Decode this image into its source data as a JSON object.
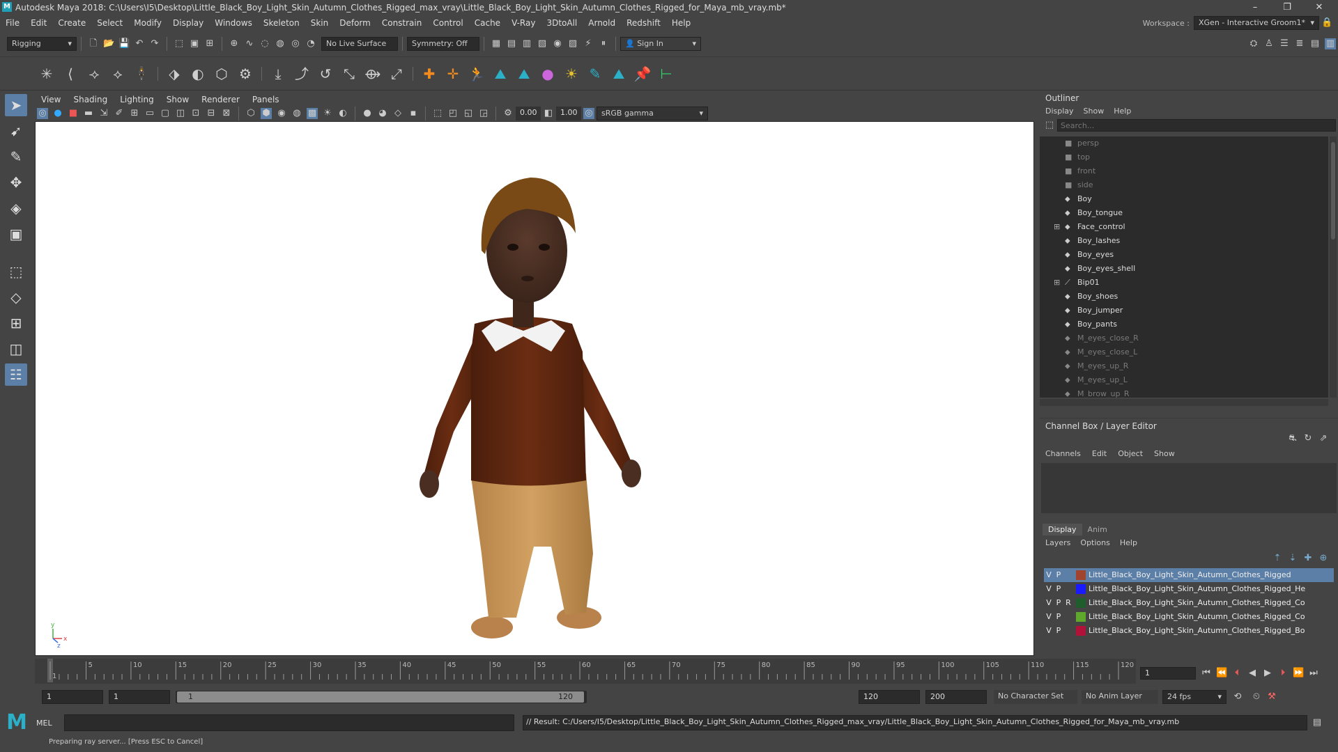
{
  "window": {
    "title": "Autodesk Maya 2018: C:\\Users\\I5\\Desktop\\Little_Black_Boy_Light_Skin_Autumn_Clothes_Rigged_max_vray\\Little_Black_Boy_Light_Skin_Autumn_Clothes_Rigged_for_Maya_mb_vray.mb*",
    "minimize": "–",
    "maximize": "❐",
    "close": "✕"
  },
  "menu": [
    "File",
    "Edit",
    "Create",
    "Select",
    "Modify",
    "Display",
    "Windows",
    "Skeleton",
    "Skin",
    "Deform",
    "Constrain",
    "Control",
    "Cache",
    "V-Ray",
    "3DtoAll",
    "Arnold",
    "Redshift",
    "Help"
  ],
  "workspace": {
    "label": "Workspace :",
    "value": "XGen - Interactive Groom1*"
  },
  "status": {
    "mode": "Rigging",
    "live_surface": "No Live Surface",
    "symmetry": "Symmetry: Off",
    "sign_in": "Sign In"
  },
  "viewport": {
    "menu": [
      "View",
      "Shading",
      "Lighting",
      "Show",
      "Renderer",
      "Panels"
    ],
    "exposure": "0.00",
    "gamma": "1.00",
    "color_space": "sRGB gamma",
    "axis_y": "y",
    "axis_x": "x",
    "axis_z": "z"
  },
  "outliner": {
    "title": "Outliner",
    "menu": [
      "Display",
      "Show",
      "Help"
    ],
    "search_placeholder": "Search...",
    "items": [
      {
        "label": "persp",
        "kind": "camera",
        "dim": true,
        "expand": false
      },
      {
        "label": "top",
        "kind": "camera",
        "dim": true,
        "expand": false
      },
      {
        "label": "front",
        "kind": "camera",
        "dim": true,
        "expand": false
      },
      {
        "label": "side",
        "kind": "camera",
        "dim": true,
        "expand": false
      },
      {
        "label": "Boy",
        "kind": "mesh",
        "dim": false,
        "expand": false
      },
      {
        "label": "Boy_tongue",
        "kind": "mesh",
        "dim": false,
        "expand": false
      },
      {
        "label": "Face_control",
        "kind": "mesh",
        "dim": false,
        "expand": true
      },
      {
        "label": "Boy_lashes",
        "kind": "mesh",
        "dim": false,
        "expand": false
      },
      {
        "label": "Boy_eyes",
        "kind": "mesh",
        "dim": false,
        "expand": false
      },
      {
        "label": "Boy_eyes_shell",
        "kind": "mesh",
        "dim": false,
        "expand": false
      },
      {
        "label": "Bip01",
        "kind": "joint",
        "dim": false,
        "expand": true
      },
      {
        "label": "Boy_shoes",
        "kind": "mesh",
        "dim": false,
        "expand": false
      },
      {
        "label": "Boy_jumper",
        "kind": "mesh",
        "dim": false,
        "expand": false
      },
      {
        "label": "Boy_pants",
        "kind": "mesh",
        "dim": false,
        "expand": false
      },
      {
        "label": "M_eyes_close_R",
        "kind": "mesh",
        "dim": true,
        "expand": false
      },
      {
        "label": "M_eyes_close_L",
        "kind": "mesh",
        "dim": true,
        "expand": false
      },
      {
        "label": "M_eyes_up_R",
        "kind": "mesh",
        "dim": true,
        "expand": false
      },
      {
        "label": "M_eyes_up_L",
        "kind": "mesh",
        "dim": true,
        "expand": false
      },
      {
        "label": "M_brow_up_R",
        "kind": "mesh",
        "dim": true,
        "expand": false
      }
    ]
  },
  "channel_box": {
    "title": "Channel Box / Layer Editor",
    "menu": [
      "Channels",
      "Edit",
      "Object",
      "Show"
    ]
  },
  "layer_editor": {
    "tabs": [
      "Display",
      "Anim"
    ],
    "menu": [
      "Layers",
      "Options",
      "Help"
    ],
    "layers": [
      {
        "v": "V",
        "p": "P",
        "r": "",
        "color": "#a0442f",
        "name": "Little_Black_Boy_Light_Skin_Autumn_Clothes_Rigged",
        "selected": true
      },
      {
        "v": "V",
        "p": "P",
        "r": "",
        "color": "#1a1aff",
        "name": "Little_Black_Boy_Light_Skin_Autumn_Clothes_Rigged_He",
        "selected": false
      },
      {
        "v": "V",
        "p": "P",
        "r": "R",
        "color": "#1f5e2c",
        "name": "Little_Black_Boy_Light_Skin_Autumn_Clothes_Rigged_Co",
        "selected": false
      },
      {
        "v": "V",
        "p": "P",
        "r": "",
        "color": "#5fa82c",
        "name": "Little_Black_Boy_Light_Skin_Autumn_Clothes_Rigged_Co",
        "selected": false
      },
      {
        "v": "V",
        "p": "P",
        "r": "",
        "color": "#b0123a",
        "name": "Little_Black_Boy_Light_Skin_Autumn_Clothes_Rigged_Bo",
        "selected": false
      }
    ]
  },
  "timeline": {
    "ticks": [
      "1",
      "5",
      "10",
      "15",
      "20",
      "25",
      "30",
      "35",
      "40",
      "45",
      "50",
      "55",
      "60",
      "65",
      "70",
      "75",
      "80",
      "85",
      "90",
      "95",
      "100",
      "105",
      "110",
      "115",
      "120"
    ],
    "current_frame": "1"
  },
  "range": {
    "start": "1",
    "playback_start": "1",
    "slider_start": "1",
    "slider_end": "120",
    "playback_end": "120",
    "end": "200",
    "character_set": "No Character Set",
    "anim_layer": "No Anim Layer",
    "fps": "24 fps"
  },
  "command": {
    "lang": "MEL",
    "result": "// Result: C:/Users/I5/Desktop/Little_Black_Boy_Light_Skin_Autumn_Clothes_Rigged_max_vray/Little_Black_Boy_Light_Skin_Autumn_Clothes_Rigged_for_Maya_mb_vray.mb"
  },
  "help_line": "Preparing ray server... [Press ESC to Cancel]"
}
